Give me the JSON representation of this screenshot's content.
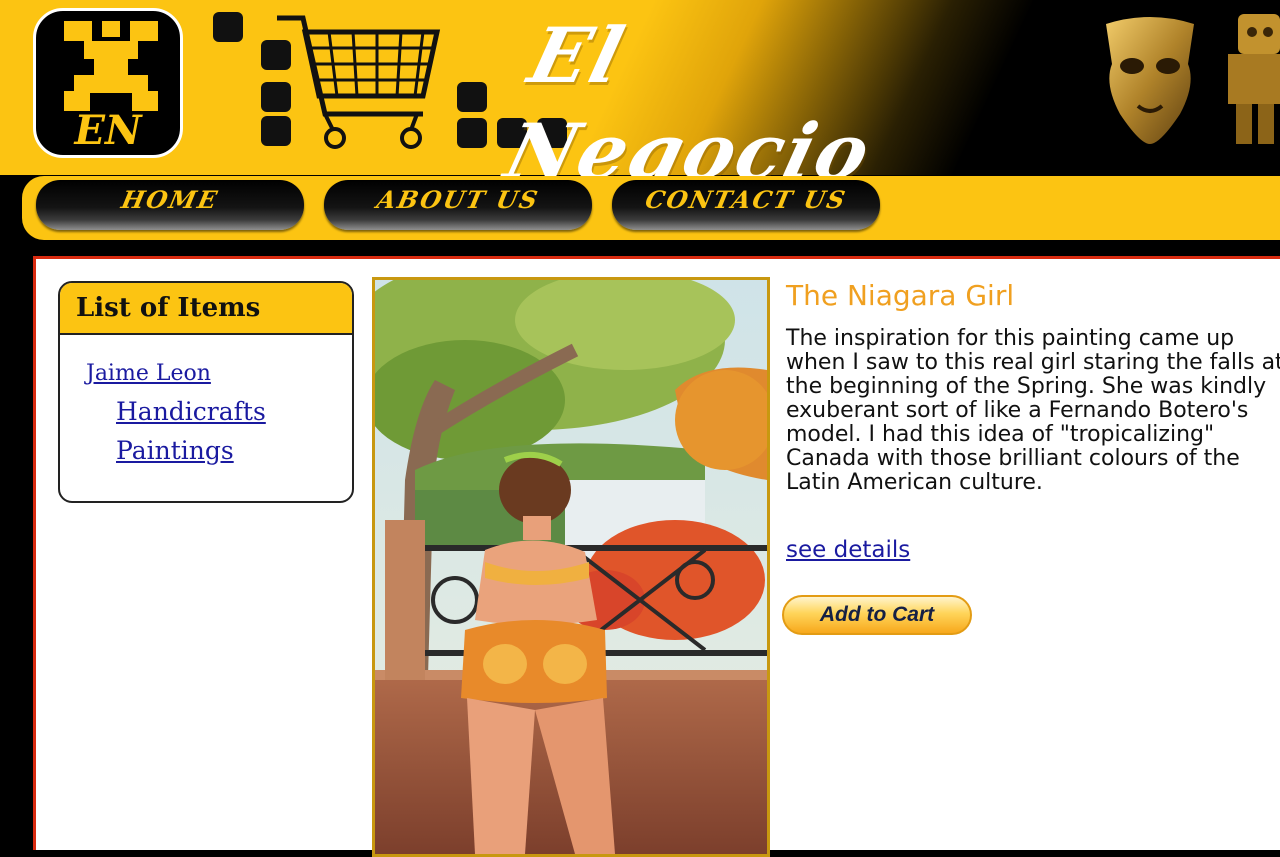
{
  "header": {
    "site_title": "El Negocio",
    "logo_text": "EN"
  },
  "nav": {
    "home": "HOME",
    "about": "ABOUT US",
    "contact": "CONTACT US"
  },
  "sidebar": {
    "title": "List of Items",
    "artist": "Jaime Leon",
    "categories": [
      "Handicrafts",
      "Paintings"
    ]
  },
  "product": {
    "title": "The Niagara Girl",
    "description": "The inspiration for this painting came up when I saw to this real girl staring the falls at the beginning of the Spring. She was kindly exuberant sort of like a Fernando Botero's model. I had this idea of \"tropicalizing\" Canada with those brilliant colours of the Latin American culture.",
    "details_link": "see details",
    "add_to_cart": "Add to Cart"
  },
  "colors": {
    "brand_yellow": "#fcc412",
    "title_orange": "#f0a020",
    "link_blue": "#1a1aa0",
    "content_border_red": "#d92b10"
  }
}
